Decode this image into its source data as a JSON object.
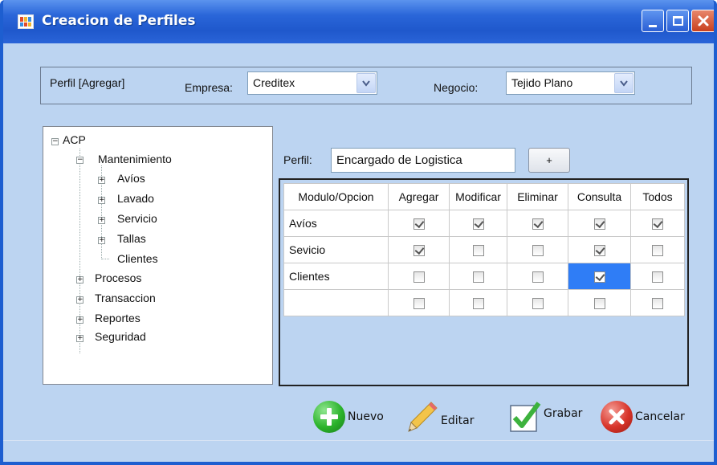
{
  "window": {
    "title": "Creacion de Perfiles"
  },
  "header": {
    "mode_label": "Perfil [Agregar]",
    "empresa_label": "Empresa:",
    "empresa_value": "Creditex",
    "negocio_label": "Negocio:",
    "negocio_value": "Tejido Plano"
  },
  "tree": {
    "root": "ACP",
    "mantenimiento": "Mantenimiento",
    "avios": "Avíos",
    "lavado": "Lavado",
    "servicio": "Servicio",
    "tallas": "Tallas",
    "clientes": "Clientes",
    "procesos": "Procesos",
    "transaccion": "Transaccion",
    "reportes": "Reportes",
    "seguridad": "Seguridad"
  },
  "perfil": {
    "label": "Perfil:",
    "value": "Encargado de Logistica",
    "add_button": "+"
  },
  "grid": {
    "columns": [
      "Modulo/Opcion",
      "Agregar",
      "Modificar",
      "Eliminar",
      "Consulta",
      "Todos"
    ],
    "rows": [
      {
        "name": "Avíos",
        "checks": [
          true,
          true,
          true,
          true,
          true
        ]
      },
      {
        "name": "Sevicio",
        "checks": [
          true,
          false,
          false,
          true,
          false
        ]
      },
      {
        "name": "Clientes",
        "checks": [
          false,
          false,
          false,
          true,
          false
        ]
      },
      {
        "name": "",
        "checks": [
          false,
          false,
          false,
          false,
          false
        ]
      }
    ],
    "selected_cell": {
      "row": 2,
      "col": 3
    }
  },
  "actions": {
    "nuevo": "Nuevo",
    "editar": "Editar",
    "grabar": "Grabar",
    "cancelar": "Cancelar"
  },
  "colors": {
    "title_bar": "#2a66d9",
    "window_bg": "#bcd4f1",
    "selection": "#2f7df6",
    "nuevo_icon": "#2bb32b",
    "cancelar_icon": "#d8342a"
  },
  "icons": {
    "app": "app-icon",
    "minimize": "minimize-icon",
    "maximize": "maximize-icon",
    "close": "close-icon",
    "nuevo": "plus-circle-icon",
    "editar": "pencil-icon",
    "grabar": "checkmark-icon",
    "cancelar": "x-circle-icon"
  }
}
